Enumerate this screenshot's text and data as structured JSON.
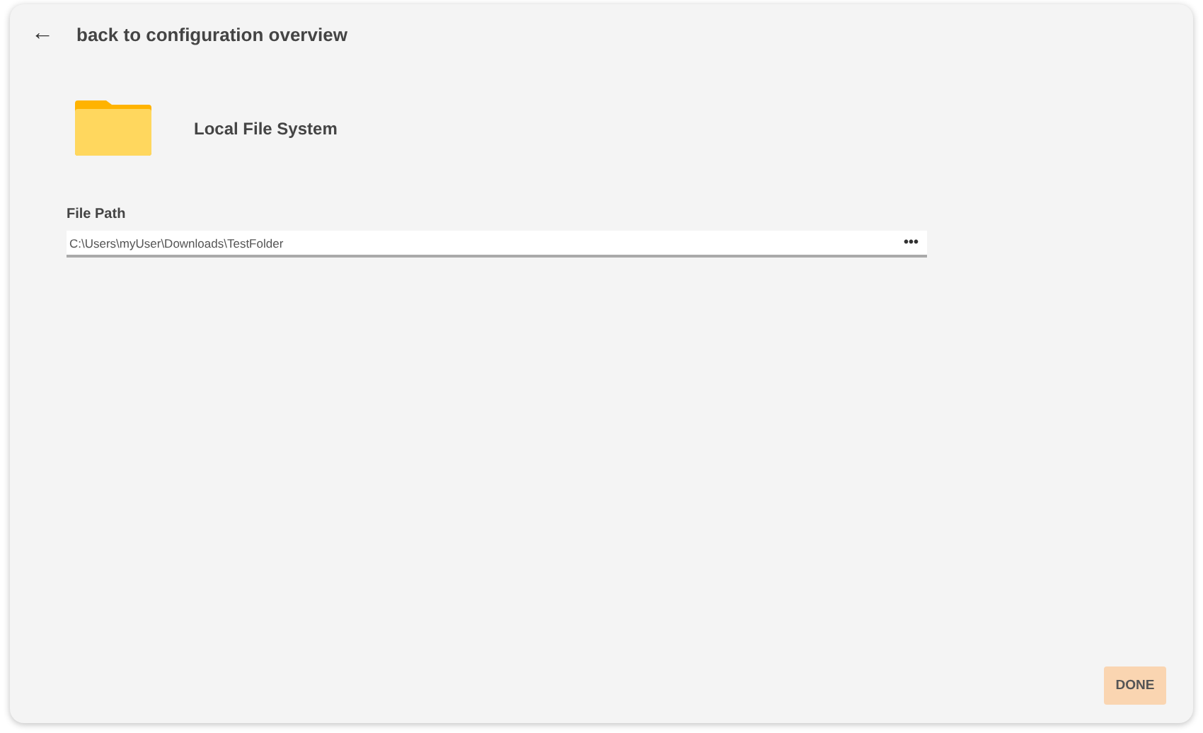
{
  "header": {
    "back_icon": "←",
    "title": "back to configuration overview"
  },
  "source": {
    "title": "Local File System"
  },
  "file_path": {
    "label": "File Path",
    "value": "C:\\Users\\myUser\\Downloads\\TestFolder",
    "browse": "•••"
  },
  "done_button": "DONE"
}
